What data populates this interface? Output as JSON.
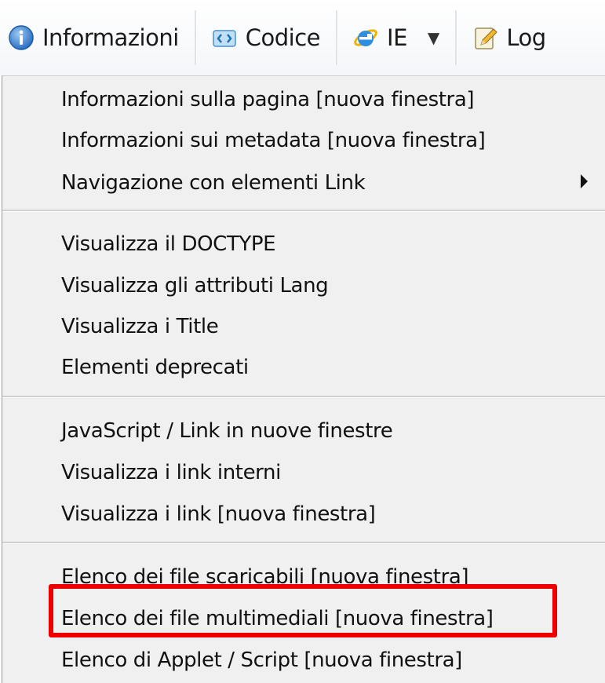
{
  "toolbar": {
    "buttons": [
      {
        "label": "Informazioni",
        "icon": "info-icon"
      },
      {
        "label": "Codice",
        "icon": "code-icon"
      },
      {
        "label": "IE",
        "icon": "ie-icon"
      },
      {
        "label": "Log",
        "icon": "notepad-icon"
      }
    ]
  },
  "menu": {
    "groups": [
      [
        {
          "label": "Informazioni sulla pagina [nuova finestra]"
        },
        {
          "label": "Informazioni sui metadata [nuova finestra]"
        },
        {
          "label": "Navigazione con elementi Link",
          "submenu": true
        }
      ],
      [
        {
          "label": "Visualizza il DOCTYPE"
        },
        {
          "label": "Visualizza gli attributi Lang"
        },
        {
          "label": "Visualizza i Title"
        },
        {
          "label": "Elementi deprecati"
        }
      ],
      [
        {
          "label": "JavaScript /  Link in nuove finestre"
        },
        {
          "label": "Visualizza i link interni"
        },
        {
          "label": "Visualizza i link [nuova finestra]"
        }
      ],
      [
        {
          "label": "Elenco dei file scaricabili [nuova finestra]"
        },
        {
          "label": "Elenco dei file multimediali [nuova finestra]",
          "highlighted": true
        },
        {
          "label": "Elenco di Applet / Script [nuova finestra]"
        }
      ]
    ]
  },
  "colors": {
    "highlight_border": "#ee0000",
    "menu_background": "#f0f0f0"
  }
}
